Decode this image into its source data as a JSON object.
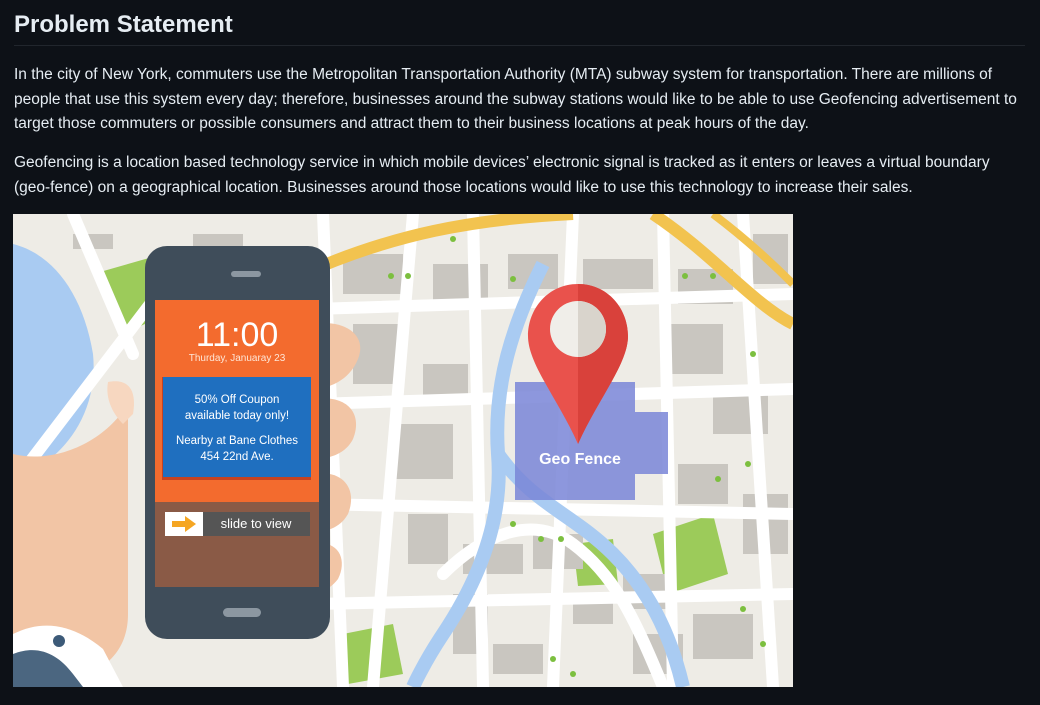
{
  "heading": "Problem Statement",
  "paragraphs": [
    "In the city of New York, commuters use the Metropolitan Transportation Authority (MTA) subway system for transportation. There are millions of people that use this system every day; therefore, businesses around the subway stations would like to be able to use Geofencing advertisement to target those commuters or possible consumers and attract them to their business locations at peak hours of the day.",
    "Geofencing is a location based technology service in which mobile devices’ electronic signal is tracked as it enters or leaves a virtual boundary (geo-fence) on a geographical location. Businesses around those locations would like to use this technology to increase their sales."
  ],
  "illustration": {
    "phone": {
      "time": "11:00",
      "date": "Thurday, Januaray 23",
      "coupon_line1": "50% Off Coupon",
      "coupon_line2": "available today only!",
      "nearby_line1": "Nearby at Bane Clothes",
      "nearby_line2": "454 22nd Ave.",
      "slide_label": "slide to view"
    },
    "geofence_label": "Geo Fence",
    "colors": {
      "map_bg": "#eeece6",
      "road": "#ffffff",
      "block": "#c9c6c0",
      "park": "#9ccb5a",
      "water": "#a9cbf2",
      "highway": "#f2c34f",
      "fence": "#7a86d8",
      "pin": "#e9524c",
      "phone_body": "#3f4d5a",
      "screen_orange": "#f36b2e",
      "coupon_blue": "#1f6fbf",
      "skin": "#f2c5a5"
    }
  }
}
